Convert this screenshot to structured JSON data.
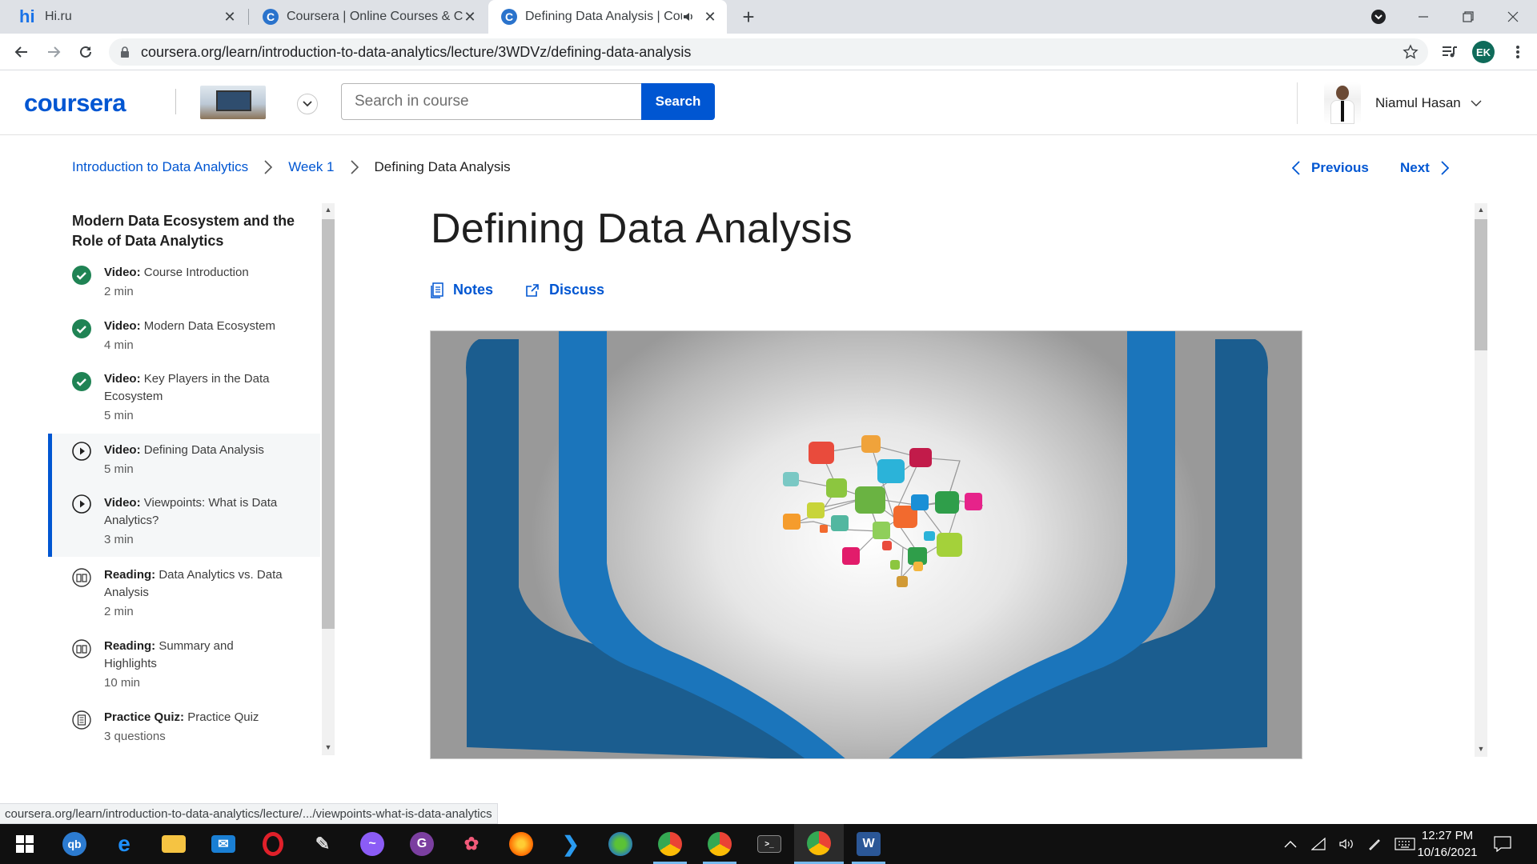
{
  "browser": {
    "tabs": [
      {
        "title": "Hi.ru",
        "favicon": "hi"
      },
      {
        "title": "Coursera | Online Courses & Crec",
        "favicon": "c"
      },
      {
        "title": "Defining Data Analysis | Cou",
        "favicon": "c",
        "active": true
      }
    ],
    "url": "coursera.org/learn/introduction-to-data-analytics/lecture/3WDVz/defining-data-analysis",
    "profile_initials": "EK"
  },
  "header": {
    "logo": "coursera",
    "search_placeholder": "Search in course",
    "search_button": "Search",
    "user_name": "Niamul Hasan"
  },
  "breadcrumb": {
    "course": "Introduction to Data Analytics",
    "week": "Week 1",
    "current": "Defining Data Analysis"
  },
  "nav": {
    "previous": "Previous",
    "next": "Next"
  },
  "sidebar": {
    "module_title": "Modern Data Ecosystem and the Role of Data Analytics",
    "items": [
      {
        "type": "Video:",
        "title": "Course Introduction",
        "duration": "2 min",
        "status": "completed"
      },
      {
        "type": "Video:",
        "title": "Modern Data Ecosystem",
        "duration": "4 min",
        "status": "completed"
      },
      {
        "type": "Video:",
        "title": "Key Players in the Data Ecosystem",
        "duration": "5 min",
        "status": "completed"
      },
      {
        "type": "Video:",
        "title": "Defining Data Analysis",
        "duration": "5 min",
        "status": "current"
      },
      {
        "type": "Video:",
        "title": "Viewpoints: What is Data Analytics?",
        "duration": "3 min",
        "status": "current"
      },
      {
        "type": "Reading:",
        "title": "Data Analytics vs. Data Analysis",
        "duration": "2 min",
        "status": "reading"
      },
      {
        "type": "Reading:",
        "title": "Summary and Highlights",
        "duration": "10 min",
        "status": "reading"
      },
      {
        "type": "Practice Quiz:",
        "title": "Practice Quiz",
        "duration": "3 questions",
        "status": "quiz"
      }
    ]
  },
  "main": {
    "title": "Defining Data Analysis",
    "notes_label": "Notes",
    "discuss_label": "Discuss"
  },
  "status_url": "coursera.org/learn/introduction-to-data-analytics/lecture/.../viewpoints-what-is-data-analytics",
  "taskbar": {
    "time": "12:27 PM",
    "date": "10/16/2021"
  },
  "colors": {
    "brand": "#0056d2",
    "completed": "#1f8354",
    "video_blue": "#1b75bb"
  }
}
